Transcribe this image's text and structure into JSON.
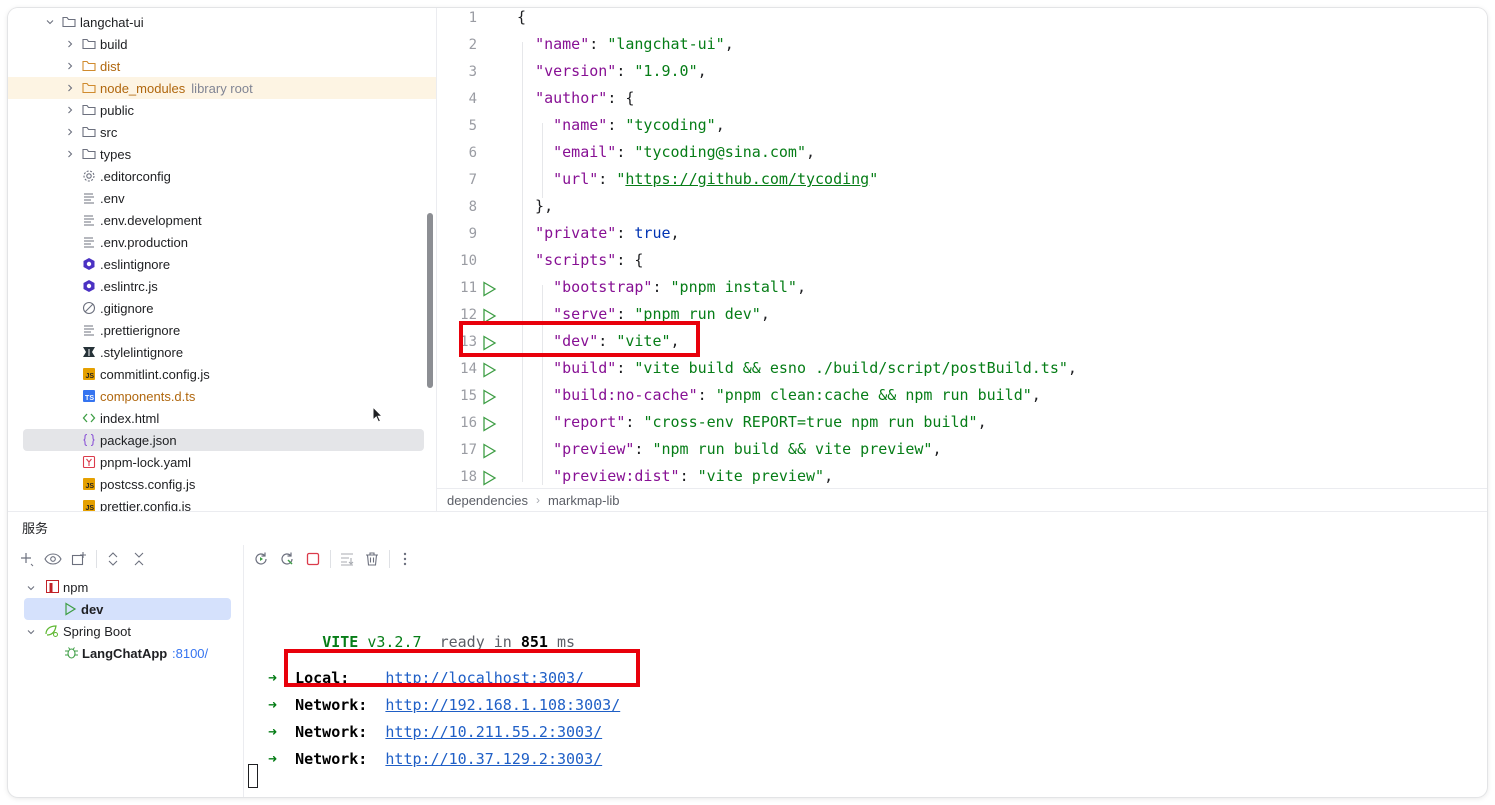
{
  "tree": {
    "items": [
      {
        "label": "langchat-ui",
        "type": "folder",
        "expanded": true,
        "depth": 0
      },
      {
        "label": "build",
        "type": "folder",
        "depth": 1
      },
      {
        "label": "dist",
        "type": "folder",
        "depth": 1,
        "color": "orange"
      },
      {
        "label": "node_modules",
        "hint": "library root",
        "type": "folder",
        "depth": 1,
        "color": "orange",
        "highlighted": true
      },
      {
        "label": "public",
        "type": "folder",
        "depth": 1
      },
      {
        "label": "src",
        "type": "folder",
        "depth": 1
      },
      {
        "label": "types",
        "type": "folder",
        "depth": 1
      },
      {
        "label": ".editorconfig",
        "type": "gear",
        "depth": 1
      },
      {
        "label": ".env",
        "type": "text",
        "depth": 1
      },
      {
        "label": ".env.development",
        "type": "text",
        "depth": 1
      },
      {
        "label": ".env.production",
        "type": "text",
        "depth": 1
      },
      {
        "label": ".eslintignore",
        "type": "eslint",
        "depth": 1
      },
      {
        "label": ".eslintrc.js",
        "type": "eslint",
        "depth": 1
      },
      {
        "label": ".gitignore",
        "type": "ignore",
        "depth": 1
      },
      {
        "label": ".prettierignore",
        "type": "text",
        "depth": 1
      },
      {
        "label": ".stylelintignore",
        "type": "stylelint",
        "depth": 1
      },
      {
        "label": "commitlint.config.js",
        "type": "js",
        "depth": 1
      },
      {
        "label": "components.d.ts",
        "type": "ts",
        "depth": 1,
        "color": "orange"
      },
      {
        "label": "index.html",
        "type": "html",
        "depth": 1
      },
      {
        "label": "package.json",
        "type": "json",
        "depth": 1,
        "selected": true
      },
      {
        "label": "pnpm-lock.yaml",
        "type": "yaml",
        "depth": 1
      },
      {
        "label": "postcss.config.js",
        "type": "js",
        "depth": 1
      },
      {
        "label": "prettier.config.js",
        "type": "js",
        "depth": 1
      }
    ]
  },
  "editor": {
    "lines": [
      {
        "n": "1",
        "tokens": [
          {
            "t": "{",
            "c": "p"
          }
        ]
      },
      {
        "n": "2",
        "tokens": [
          {
            "t": "  ",
            "c": "p"
          },
          {
            "t": "\"name\"",
            "c": "k"
          },
          {
            "t": ": ",
            "c": "p"
          },
          {
            "t": "\"langchat-ui\"",
            "c": "s"
          },
          {
            "t": ",",
            "c": "p"
          }
        ]
      },
      {
        "n": "3",
        "tokens": [
          {
            "t": "  ",
            "c": "p"
          },
          {
            "t": "\"version\"",
            "c": "k"
          },
          {
            "t": ": ",
            "c": "p"
          },
          {
            "t": "\"1.9.0\"",
            "c": "s"
          },
          {
            "t": ",",
            "c": "p"
          }
        ]
      },
      {
        "n": "4",
        "tokens": [
          {
            "t": "  ",
            "c": "p"
          },
          {
            "t": "\"author\"",
            "c": "k"
          },
          {
            "t": ": {",
            "c": "p"
          }
        ]
      },
      {
        "n": "5",
        "tokens": [
          {
            "t": "    ",
            "c": "p"
          },
          {
            "t": "\"name\"",
            "c": "k"
          },
          {
            "t": ": ",
            "c": "p"
          },
          {
            "t": "\"tycoding\"",
            "c": "s"
          },
          {
            "t": ",",
            "c": "p"
          }
        ]
      },
      {
        "n": "6",
        "tokens": [
          {
            "t": "    ",
            "c": "p"
          },
          {
            "t": "\"email\"",
            "c": "k"
          },
          {
            "t": ": ",
            "c": "p"
          },
          {
            "t": "\"tycoding@sina.com\"",
            "c": "s"
          },
          {
            "t": ",",
            "c": "p"
          }
        ]
      },
      {
        "n": "7",
        "tokens": [
          {
            "t": "    ",
            "c": "p"
          },
          {
            "t": "\"url\"",
            "c": "k"
          },
          {
            "t": ": ",
            "c": "p"
          },
          {
            "t": "\"",
            "c": "s"
          },
          {
            "t": "https://github.com/tycoding",
            "c": "u"
          },
          {
            "t": "\"",
            "c": "s"
          }
        ]
      },
      {
        "n": "8",
        "tokens": [
          {
            "t": "  },",
            "c": "p"
          }
        ]
      },
      {
        "n": "9",
        "tokens": [
          {
            "t": "  ",
            "c": "p"
          },
          {
            "t": "\"private\"",
            "c": "k"
          },
          {
            "t": ": ",
            "c": "p"
          },
          {
            "t": "true",
            "c": "b"
          },
          {
            "t": ",",
            "c": "p"
          }
        ]
      },
      {
        "n": "10",
        "tokens": [
          {
            "t": "  ",
            "c": "p"
          },
          {
            "t": "\"scripts\"",
            "c": "k"
          },
          {
            "t": ": {",
            "c": "p"
          }
        ]
      },
      {
        "n": "11",
        "run": true,
        "tokens": [
          {
            "t": "    ",
            "c": "p"
          },
          {
            "t": "\"bootstrap\"",
            "c": "k"
          },
          {
            "t": ": ",
            "c": "p"
          },
          {
            "t": "\"pnpm install\"",
            "c": "s"
          },
          {
            "t": ",",
            "c": "p"
          }
        ]
      },
      {
        "n": "12",
        "run": true,
        "tokens": [
          {
            "t": "    ",
            "c": "p"
          },
          {
            "t": "\"serve\"",
            "c": "k"
          },
          {
            "t": ": ",
            "c": "p"
          },
          {
            "t": "\"pnpm run dev\"",
            "c": "s"
          },
          {
            "t": ",",
            "c": "p"
          }
        ]
      },
      {
        "n": "13",
        "run": true,
        "tokens": [
          {
            "t": "    ",
            "c": "p"
          },
          {
            "t": "\"dev\"",
            "c": "k"
          },
          {
            "t": ": ",
            "c": "p"
          },
          {
            "t": "\"vite\"",
            "c": "s"
          },
          {
            "t": ",",
            "c": "p"
          }
        ]
      },
      {
        "n": "14",
        "run": true,
        "tokens": [
          {
            "t": "    ",
            "c": "p"
          },
          {
            "t": "\"build\"",
            "c": "k"
          },
          {
            "t": ": ",
            "c": "p"
          },
          {
            "t": "\"vite build && esno ./build/script/postBuild.ts\"",
            "c": "s"
          },
          {
            "t": ",",
            "c": "p"
          }
        ]
      },
      {
        "n": "15",
        "run": true,
        "tokens": [
          {
            "t": "    ",
            "c": "p"
          },
          {
            "t": "\"build:no-cache\"",
            "c": "k"
          },
          {
            "t": ": ",
            "c": "p"
          },
          {
            "t": "\"pnpm clean:cache && npm run build\"",
            "c": "s"
          },
          {
            "t": ",",
            "c": "p"
          }
        ]
      },
      {
        "n": "16",
        "run": true,
        "tokens": [
          {
            "t": "    ",
            "c": "p"
          },
          {
            "t": "\"report\"",
            "c": "k"
          },
          {
            "t": ": ",
            "c": "p"
          },
          {
            "t": "\"cross-env REPORT=true npm run build\"",
            "c": "s"
          },
          {
            "t": ",",
            "c": "p"
          }
        ]
      },
      {
        "n": "17",
        "run": true,
        "tokens": [
          {
            "t": "    ",
            "c": "p"
          },
          {
            "t": "\"preview\"",
            "c": "k"
          },
          {
            "t": ": ",
            "c": "p"
          },
          {
            "t": "\"npm run build && vite preview\"",
            "c": "s"
          },
          {
            "t": ",",
            "c": "p"
          }
        ]
      },
      {
        "n": "18",
        "run": true,
        "tokens": [
          {
            "t": "    ",
            "c": "p"
          },
          {
            "t": "\"preview:dist\"",
            "c": "k"
          },
          {
            "t": ": ",
            "c": "p"
          },
          {
            "t": "\"vite preview\"",
            "c": "s"
          },
          {
            "t": ",",
            "c": "p"
          }
        ]
      }
    ],
    "breadcrumb": [
      "dependencies",
      "markmap-lib"
    ]
  },
  "services": {
    "title": "服务",
    "tree": [
      {
        "label": "npm",
        "icon": "npm-icon",
        "depth": 0,
        "expanded": true
      },
      {
        "label": "dev",
        "icon": "run-icon",
        "depth": 1,
        "selected": true,
        "bold": true
      },
      {
        "label": "Spring Boot",
        "icon": "spring-icon",
        "depth": 0,
        "expanded": true
      },
      {
        "label": "LangChatApp",
        "port": ":8100/",
        "icon": "bug-icon",
        "depth": 1,
        "bold": true
      }
    ]
  },
  "console": {
    "vite_name": "VITE",
    "vite_version": "v3.2.7",
    "ready_text": "ready in",
    "ready_ms": "851",
    "ready_unit": "ms",
    "arrow": "➜",
    "entries": [
      {
        "label": "Local:",
        "url": "http://localhost:3003/"
      },
      {
        "label": "Network:",
        "url": "http://192.168.1.108:3003/"
      },
      {
        "label": "Network:",
        "url": "http://10.211.55.2:3003/"
      },
      {
        "label": "Network:",
        "url": "http://10.37.129.2:3003/"
      }
    ]
  },
  "colors": {
    "keyword": "#871094",
    "string": "#067d17",
    "literal": "#0033b3",
    "link": "#1f5fc6",
    "highlight_box": "#e8000b",
    "selection": "#e4e5e8",
    "library_row": "#fdf4e3"
  }
}
